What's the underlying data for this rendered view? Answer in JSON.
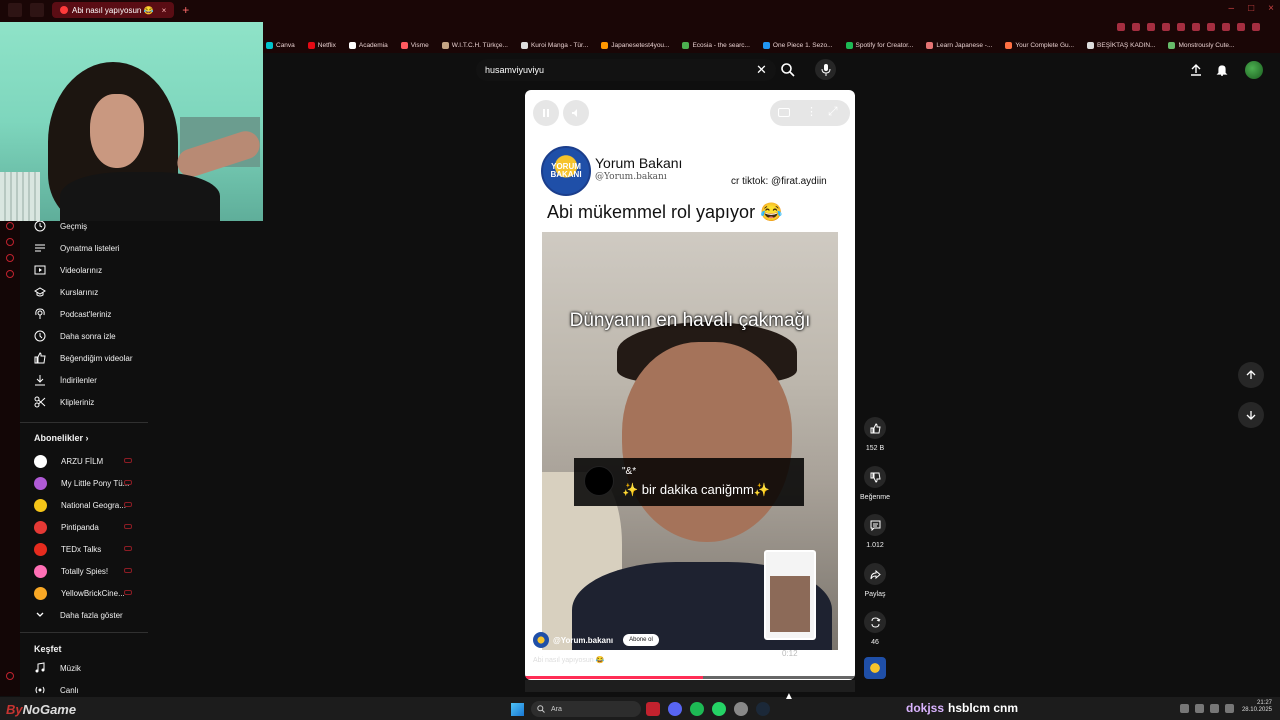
{
  "browser": {
    "tab_title": "Abi nasıl yapıyosun 😂",
    "bookmarks": [
      {
        "label": "Canva",
        "color": "#00c4cc"
      },
      {
        "label": "Netflix",
        "color": "#e50914"
      },
      {
        "label": "Academia",
        "color": "#ffffff"
      },
      {
        "label": "Visme",
        "color": "#ff5a5f"
      },
      {
        "label": "W.I.T.C.H. Türkçe...",
        "color": "#c4a484"
      },
      {
        "label": "Kuroi Manga - Tür...",
        "color": "#dddddd"
      },
      {
        "label": "Japanesetest4you...",
        "color": "#ff9800"
      },
      {
        "label": "Ecosia - the searc...",
        "color": "#4caf50"
      },
      {
        "label": "One Piece 1. Sezo...",
        "color": "#2196f3"
      },
      {
        "label": "Spotify for Creator...",
        "color": "#1db954"
      },
      {
        "label": "Learn Japanese -...",
        "color": "#e57373"
      },
      {
        "label": "Your Complete Gu...",
        "color": "#ff7043"
      },
      {
        "label": "BEŞİKTAŞ KADIN...",
        "color": "#dddddd"
      },
      {
        "label": "Monstrously Cute...",
        "color": "#66bb6a"
      }
    ]
  },
  "search": {
    "query": "husamviyuviyu"
  },
  "sidebar": {
    "you_items": [
      {
        "label": "Geçmiş",
        "icon": "history-icon"
      },
      {
        "label": "Oynatma listeleri",
        "icon": "playlist-icon"
      },
      {
        "label": "Videolarınız",
        "icon": "your-videos-icon"
      },
      {
        "label": "Kurslarınız",
        "icon": "courses-icon"
      },
      {
        "label": "Podcast'leriniz",
        "icon": "podcast-icon"
      },
      {
        "label": "Daha sonra izle",
        "icon": "watch-later-icon"
      },
      {
        "label": "Beğendiğim videolar",
        "icon": "like-icon"
      },
      {
        "label": "İndirilenler",
        "icon": "download-icon"
      },
      {
        "label": "Klipleriniz",
        "icon": "scissors-icon"
      }
    ],
    "subscriptions_heading": "Abonelikler",
    "subscriptions": [
      {
        "label": "ARZU FİLM",
        "color": "#ffffff"
      },
      {
        "label": "My Little Pony Tü...",
        "color": "#b05ad6"
      },
      {
        "label": "National Geogra...",
        "color": "#f5c518"
      },
      {
        "label": "Pintipanda",
        "color": "#e53935"
      },
      {
        "label": "TEDx Talks",
        "color": "#e62b1e"
      },
      {
        "label": "Totally Spies!",
        "color": "#ff6fb5"
      },
      {
        "label": "YellowBrickCine...",
        "color": "#f9a825"
      }
    ],
    "show_more": "Daha fazla göster",
    "explore_heading": "Keşfet",
    "explore_items": [
      {
        "label": "Müzik",
        "icon": "music-icon"
      },
      {
        "label": "Canlı",
        "icon": "live-icon"
      }
    ]
  },
  "short": {
    "channel_name": "Yorum Bakanı",
    "channel_handle": "@Yorum.bakanı",
    "logo_text": "YORUM BAKANI",
    "credit": "cr tiktok: @firat.aydiin",
    "caption": "Abi mükemmel rol yapıyor 😂",
    "video_overlay_title": "Dünyanın en havalı çakmağı",
    "tweet_name": "\"&*",
    "tweet_text": "✨ bir dakika caniğmm✨",
    "bottom_channel": "@Yorum.bakanı",
    "subscribe_label": "Abone ol",
    "title": "Abi nasıl yapıyosun 😂",
    "time": "0:12",
    "progress": 0.54
  },
  "actions": {
    "likes": "152 B",
    "dislike_label": "Beğenme",
    "comments": "1.012",
    "share_label": "Paylaş",
    "remix_count": "46"
  },
  "taskbar": {
    "search_placeholder": "Ara",
    "chat_user": "dokjss",
    "chat_message": "hsblcm cnm",
    "time": "21:27",
    "date": "28.10.2025"
  },
  "watermark": {
    "text_by": "By",
    "text_rest": "NoGame"
  },
  "colors": {
    "accent_red": "#ff2d55",
    "youtube_bg": "#0f0f0f",
    "browser_chrome": "#1a0606"
  }
}
